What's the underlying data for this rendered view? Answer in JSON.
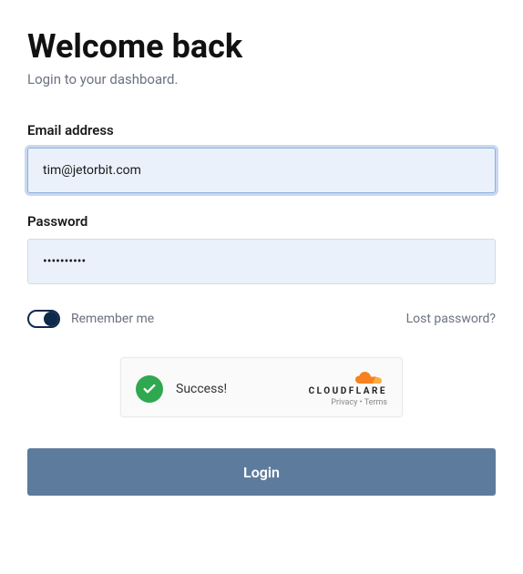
{
  "header": {
    "title": "Welcome back",
    "subtitle": "Login to your dashboard."
  },
  "form": {
    "email": {
      "label": "Email address",
      "value": "tim@jetorbit.com"
    },
    "password": {
      "label": "Password",
      "value": "••••••••••"
    },
    "remember": {
      "label": "Remember me",
      "checked": true
    },
    "lost_password_label": "Lost password?",
    "submit_label": "Login"
  },
  "captcha": {
    "status_text": "Success!",
    "brand": "CLOUDFLARE",
    "privacy_label": "Privacy",
    "terms_label": "Terms",
    "separator": " • "
  }
}
